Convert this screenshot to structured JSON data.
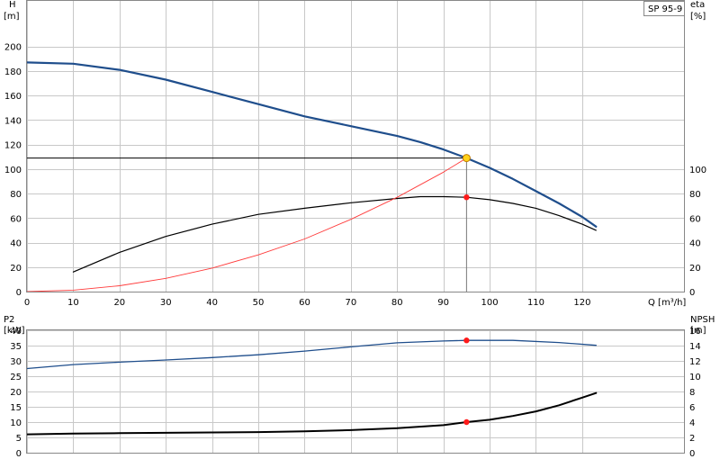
{
  "chart_data": {
    "type": "line",
    "title": "SP 95-9",
    "x_axis": {
      "label": "Q [m³/h]",
      "ticks": [
        0,
        10,
        20,
        30,
        40,
        50,
        60,
        70,
        80,
        90,
        100,
        110,
        120
      ],
      "range": [
        0,
        142
      ]
    },
    "duty_point": {
      "q": 95,
      "h": 109,
      "eta": 77,
      "p2": 36.7,
      "npsh": 4
    },
    "panels": [
      {
        "id": "top",
        "left_axis": {
          "title": "H",
          "unit": "[m]",
          "ticks": [
            0,
            20,
            40,
            60,
            80,
            100,
            120,
            140,
            160,
            180,
            200
          ],
          "range": [
            0,
            238
          ]
        },
        "right_axis": {
          "title": "eta",
          "unit": "[%]",
          "ticks": [
            0,
            20,
            40,
            60,
            80,
            100
          ],
          "range": [
            0,
            238
          ]
        },
        "series": [
          {
            "axis": "left",
            "color": "#1f4e8c",
            "width": 2.2,
            "x": [
              0,
              10,
              20,
              30,
              40,
              50,
              60,
              70,
              80,
              85,
              90,
              95,
              100,
              105,
              110,
              115,
              120,
              123
            ],
            "y": [
              187,
              186,
              181,
              173,
              163,
              153,
              143,
              135,
              127,
              122,
              116,
              109,
              101,
              92,
              82,
              72,
              61,
              53
            ]
          },
          {
            "axis": "right",
            "color": "#000000",
            "width": 1.2,
            "x": [
              10,
              20,
              30,
              40,
              50,
              60,
              70,
              80,
              85,
              90,
              95,
              100,
              105,
              110,
              115,
              120,
              123
            ],
            "y": [
              16,
              32,
              45,
              55,
              63,
              68,
              72.5,
              76,
              77.5,
              77.5,
              77,
              75,
              72,
              68,
              62,
              55,
              50
            ]
          },
          {
            "axis": "left",
            "color": "#ff3b3b",
            "width": 0.9,
            "x": [
              0,
              10,
              20,
              30,
              40,
              50,
              60,
              70,
              80,
              90,
              95
            ],
            "y": [
              0,
              1.2,
              4.8,
              10.8,
              19.2,
              30,
              43,
              59,
              77,
              97.5,
              109
            ]
          },
          {
            "axis": "left",
            "color": "#000000",
            "width": 1,
            "kind": "duty-h-line",
            "x": [
              0,
              95
            ],
            "y": [
              109,
              109
            ]
          }
        ]
      },
      {
        "id": "bottom",
        "left_axis": {
          "title": "P2",
          "unit": "[kW]",
          "ticks": [
            0,
            5,
            10,
            15,
            20,
            25,
            30,
            35,
            40
          ],
          "range": [
            0,
            40
          ]
        },
        "right_axis": {
          "title": "NPSH",
          "unit": "[m]",
          "ticks": [
            0,
            2,
            4,
            6,
            8,
            10,
            12,
            14,
            16
          ],
          "range": [
            0,
            16
          ]
        },
        "series": [
          {
            "axis": "left",
            "color": "#1f4e8c",
            "width": 1.3,
            "x": [
              0,
              10,
              20,
              30,
              40,
              50,
              60,
              70,
              80,
              90,
              95,
              105,
              115,
              123
            ],
            "y": [
              27.5,
              28.8,
              29.6,
              30.3,
              31.1,
              32.0,
              33.2,
              34.6,
              35.9,
              36.5,
              36.7,
              36.7,
              36.0,
              35.1
            ]
          },
          {
            "axis": "right",
            "color": "#000000",
            "width": 2,
            "x": [
              0,
              10,
              20,
              30,
              40,
              50,
              60,
              70,
              80,
              90,
              95,
              100,
              105,
              110,
              115,
              120,
              123
            ],
            "y": [
              2.4,
              2.5,
              2.55,
              2.6,
              2.65,
              2.7,
              2.8,
              2.95,
              3.2,
              3.6,
              4.0,
              4.3,
              4.8,
              5.4,
              6.2,
              7.2,
              7.8
            ]
          }
        ]
      }
    ]
  }
}
